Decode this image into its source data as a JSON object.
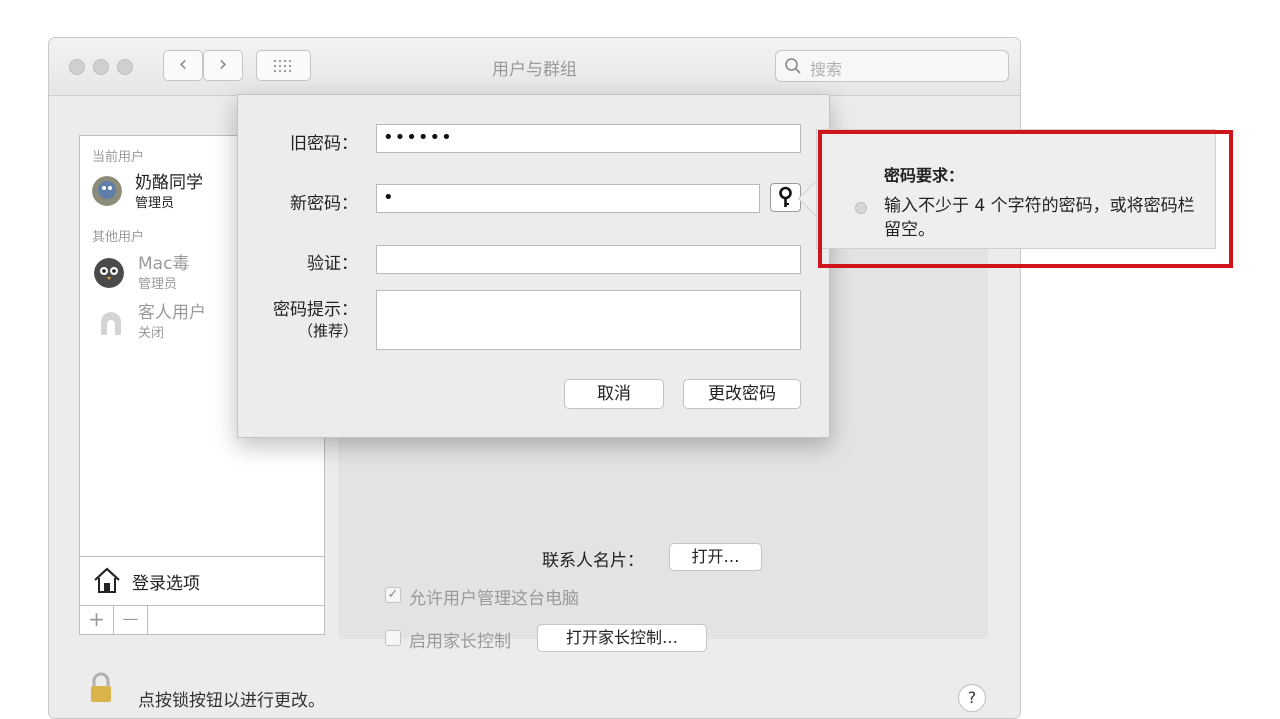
{
  "window": {
    "title": "用户与群组"
  },
  "search": {
    "placeholder": "搜索"
  },
  "sidebar": {
    "current_label": "当前用户",
    "current_user": {
      "name": "奶酪同学",
      "role": "管理员"
    },
    "other_label": "其他用户",
    "others": [
      {
        "name": "Mac毒",
        "role": "管理员"
      },
      {
        "name": "客人用户",
        "role": "关闭"
      }
    ],
    "login_options": "登录选项",
    "add": "+",
    "remove": "—"
  },
  "panel": {
    "contact_card_label": "联系人名片：",
    "contact_open_button": "打开…",
    "allow_admin_label": "允许用户管理这台电脑",
    "allow_admin_checked": true,
    "parental_label": "启用家长控制",
    "parental_checked": false,
    "parental_button": "打开家长控制…"
  },
  "footer": {
    "lock_hint": "点按锁按钮以进行更改。",
    "help": "?"
  },
  "sheet": {
    "old_password_label": "旧密码：",
    "old_password_value": "••••••",
    "new_password_label": "新密码：",
    "new_password_value": "•",
    "verify_label": "验证：",
    "hint_label": "密码提示：",
    "hint_sublabel": "（推荐）",
    "cancel_button": "取消",
    "change_button": "更改密码"
  },
  "popover": {
    "title": "密码要求：",
    "requirement": "输入不少于 4 个字符的密码，或将密码栏留空。"
  },
  "colors": {
    "highlight_border": "#d0141c"
  }
}
